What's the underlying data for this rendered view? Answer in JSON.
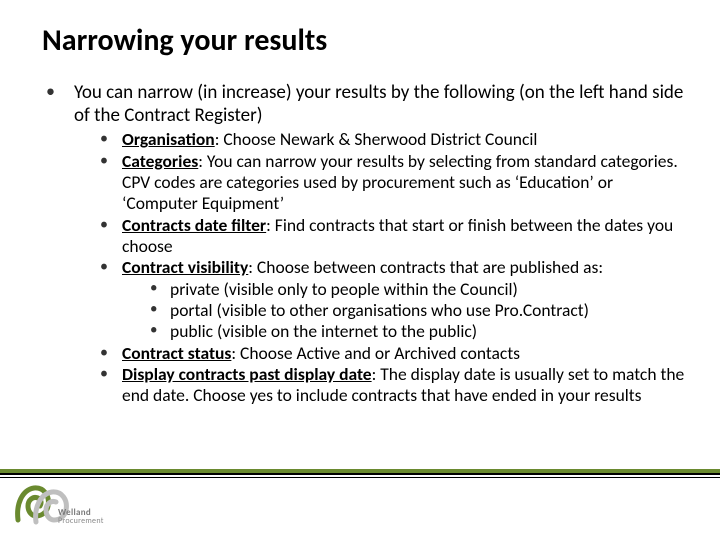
{
  "title": "Narrowing your results",
  "intro": "You can narrow (in increase) your results by the following (on the left hand side of the Contract Register)",
  "items": {
    "org_label": "Organisation",
    "org_text": ": Choose Newark & Sherwood District Council",
    "cat_label": "Categories",
    "cat_text": ": You can narrow your results by selecting from standard categories. CPV codes are categories used by procurement such as ‘Education’ or ‘Computer Equipment’",
    "date_label": "Contracts date filter",
    "date_text": ": Find contracts that start or finish between the dates you choose",
    "vis_label": "Contract visibility",
    "vis_text": ": Choose between contracts that are published as:",
    "vis_sub": [
      "private (visible only to people within the Council)",
      "portal (visible to other organisations who use Pro.Contract)",
      "public (visible on the internet to the public)"
    ],
    "status_label": "Contract status",
    "status_text": ": Choose Active and or Archived contacts",
    "past_label": "Display contracts past display date",
    "past_text": ": The display date is usually set to match the end date. Choose yes to include contracts that have ended in your results"
  },
  "logo": {
    "line1": "Welland",
    "line2": "Procurement"
  }
}
